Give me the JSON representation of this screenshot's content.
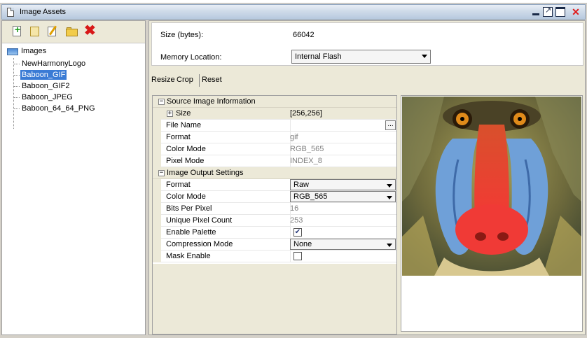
{
  "window": {
    "title": "Image Assets",
    "colors": {
      "title_gradient_top": "#e8eef6",
      "title_gradient_bottom": "#b7c9df",
      "selection": "#3a7bd5",
      "close": "#e01818"
    }
  },
  "titlebar_icons": [
    "document-icon",
    "minimize-icon",
    "float-icon",
    "maximize-icon",
    "close-icon"
  ],
  "toolbar": {
    "icons": [
      "add-image-icon",
      "rename-icon",
      "edit-icon",
      "folder-icon",
      "delete-icon"
    ]
  },
  "tree": {
    "root": "Images",
    "items": [
      "NewHarmonyLogo",
      "Baboon_GIF",
      "Baboon_GIF2",
      "Baboon_JPEG",
      "Baboon_64_64_PNG"
    ],
    "selected": "Baboon_GIF"
  },
  "info": {
    "size_label": "Size (bytes):",
    "size_value": "66042",
    "memory_label": "Memory Location:",
    "memory_value": "Internal Flash"
  },
  "actions": {
    "resize": "Resize",
    "crop": "Crop",
    "reset": "Reset"
  },
  "properties": {
    "source": {
      "header": "Source Image Information",
      "size_name": "Size",
      "size_value": "[256,256]",
      "filename_name": "File Name",
      "filename_value": "",
      "browse": "...",
      "format_name": "Format",
      "format_value": "gif",
      "colormode_name": "Color Mode",
      "colormode_value": "RGB_565",
      "pixelmode_name": "Pixel Mode",
      "pixelmode_value": "INDEX_8"
    },
    "output": {
      "header": "Image Output Settings",
      "format_name": "Format",
      "format_value": "Raw",
      "colormode_name": "Color Mode",
      "colormode_value": "RGB_565",
      "bpp_name": "Bits Per Pixel",
      "bpp_value": "16",
      "unique_name": "Unique Pixel Count",
      "unique_value": "253",
      "palette_name": "Enable Palette",
      "palette_checked": true,
      "compression_name": "Compression Mode",
      "compression_value": "None",
      "mask_name": "Mask Enable",
      "mask_checked": false
    },
    "collapse_glyph": "⊟",
    "expand_glyph": "⊞"
  },
  "preview": {
    "image": "baboon-mandrill-image"
  }
}
